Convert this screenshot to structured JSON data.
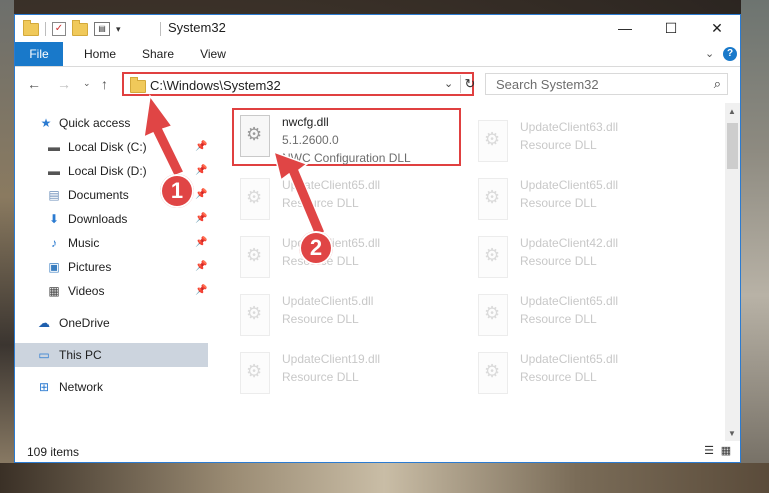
{
  "window": {
    "title": "System32",
    "controls": {
      "minimize": "—",
      "maximize": "☐",
      "close": "✕"
    }
  },
  "ribbon": {
    "tabs": [
      "File",
      "Home",
      "Share",
      "View"
    ],
    "help": "?"
  },
  "address": {
    "path": "C:\\Windows\\System32",
    "search_placeholder": "Search System32"
  },
  "sidebar": {
    "items": [
      {
        "label": "Quick access",
        "icon": "star-icon",
        "pinned": false
      },
      {
        "label": "Local Disk (C:)",
        "icon": "drive-icon",
        "pinned": true
      },
      {
        "label": "Local Disk (D:)",
        "icon": "drive-icon",
        "pinned": true
      },
      {
        "label": "Documents",
        "icon": "documents-icon",
        "pinned": true
      },
      {
        "label": "Downloads",
        "icon": "download-icon",
        "pinned": true
      },
      {
        "label": "Music",
        "icon": "music-icon",
        "pinned": true
      },
      {
        "label": "Pictures",
        "icon": "pictures-icon",
        "pinned": true
      },
      {
        "label": "Videos",
        "icon": "videos-icon",
        "pinned": true
      },
      {
        "label": "OneDrive",
        "icon": "cloud-icon",
        "pinned": false
      },
      {
        "label": "This PC",
        "icon": "computer-icon",
        "pinned": false,
        "selected": true
      },
      {
        "label": "Network",
        "icon": "network-icon",
        "pinned": false
      }
    ]
  },
  "files": {
    "highlighted": {
      "name": "nwcfg.dll",
      "version": "5.1.2600.0",
      "description": "NWC Configuration DLL"
    },
    "left_column": [
      {
        "name": "UpdateClient65.dll",
        "description": "Resource DLL"
      },
      {
        "name": "UpdateClient65.dll",
        "description": "Resource DLL"
      },
      {
        "name": "UpdateClient5.dll",
        "description": "Resource DLL"
      },
      {
        "name": "UpdateClient19.dll",
        "description": "Resource DLL"
      }
    ],
    "right_column": [
      {
        "name": "UpdateClient63.dll",
        "description": "Resource DLL"
      },
      {
        "name": "UpdateClient65.dll",
        "description": "Resource DLL"
      },
      {
        "name": "UpdateClient42.dll",
        "description": "Resource DLL"
      },
      {
        "name": "UpdateClient65.dll",
        "description": "Resource DLL"
      },
      {
        "name": "UpdateClient65.dll",
        "description": "Resource DLL"
      }
    ]
  },
  "status": {
    "count": "109 items"
  },
  "annotations": {
    "badge1": "1",
    "badge2": "2",
    "color": "#e04545"
  }
}
